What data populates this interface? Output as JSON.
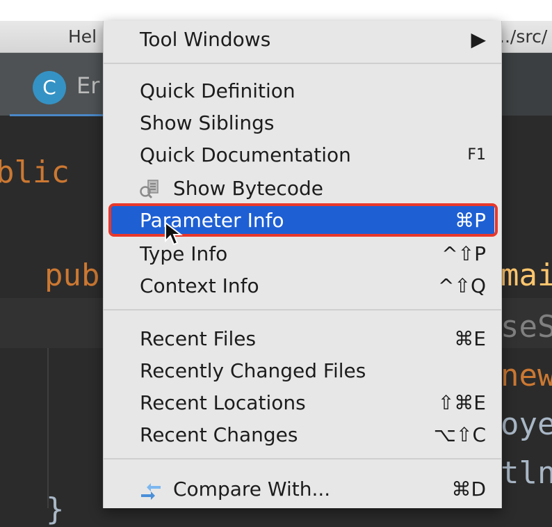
{
  "window": {
    "title_left": "Hel",
    "title_right": "../src/"
  },
  "tabs": [
    {
      "icon": "class-c-icon",
      "icon_letter": "C",
      "label": "Er"
    }
  ],
  "editor": {
    "lines": [
      {
        "text": "blic",
        "style": "keyword"
      },
      {
        "text": "pub",
        "style": "keyword"
      },
      {
        "text": "mai",
        "style": "plain"
      },
      {
        "text": "seS",
        "style": "muted"
      },
      {
        "text": "new",
        "style": "keyword"
      },
      {
        "text": "oye",
        "style": "plain"
      },
      {
        "text": "tln",
        "style": "plain"
      },
      {
        "text": "}",
        "style": "plain"
      }
    ]
  },
  "menu": {
    "tool_windows": {
      "label": "Tool Windows",
      "arrow": "▶"
    },
    "quick_definition": {
      "label": "Quick Definition"
    },
    "show_siblings": {
      "label": "Show Siblings"
    },
    "quick_documentation": {
      "label": "Quick Documentation",
      "shortcut": "F1"
    },
    "show_bytecode": {
      "label": "Show Bytecode",
      "icon": "bytecode-search-icon"
    },
    "parameter_info": {
      "label": "Parameter Info",
      "shortcut": "⌘P",
      "selected": true
    },
    "type_info": {
      "label": "Type Info",
      "shortcut": "^⇧P"
    },
    "context_info": {
      "label": "Context Info",
      "shortcut": "^⇧Q"
    },
    "recent_files": {
      "label": "Recent Files",
      "shortcut": "⌘E"
    },
    "recently_changed_files": {
      "label": "Recently Changed Files"
    },
    "recent_locations": {
      "label": "Recent Locations",
      "shortcut": "⇧⌘E"
    },
    "recent_changes": {
      "label": "Recent Changes",
      "shortcut": "⌥⇧C"
    },
    "compare_with": {
      "label": "Compare With...",
      "shortcut": "⌘D",
      "icon": "compare-arrows-icon"
    }
  },
  "colors": {
    "selection": "#1e5fd4",
    "highlight_box": "#e8382b",
    "menu_bg": "#e7e7e7",
    "editor_bg": "#2b2b2b",
    "keyword": "#cc7832"
  }
}
